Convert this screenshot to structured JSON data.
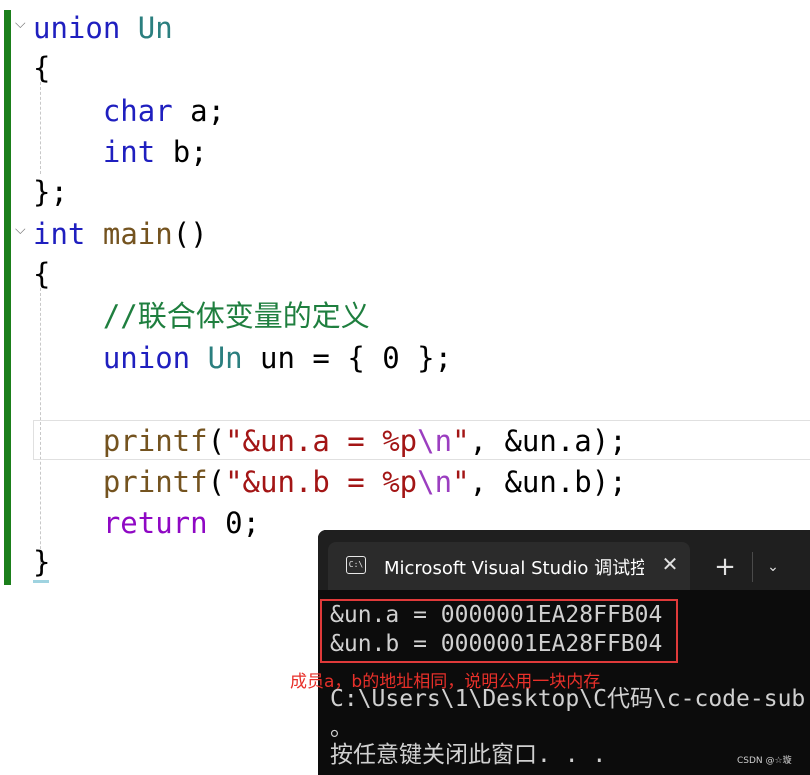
{
  "editor": {
    "code": {
      "l1": {
        "kw": "union",
        "name": "Un"
      },
      "l2": "{",
      "l3": {
        "type": "char",
        "var": "a;"
      },
      "l4": {
        "type": "int",
        "var": "b;"
      },
      "l5": "};",
      "l6": {
        "type": "int",
        "fn": "main",
        "paren": "()"
      },
      "l7": "{",
      "l8": "//联合体变量的定义",
      "l9": {
        "kw": "union",
        "type": "Un",
        "rest": "un = { 0 };"
      },
      "l11": {
        "fn": "printf",
        "open": "(",
        "str1": "\"&un.a = %p",
        "esc": "\\n",
        "str2": "\"",
        "rest": ", &un.a);"
      },
      "l12": {
        "fn": "printf",
        "open": "(",
        "str1": "\"&un.b = %p",
        "esc": "\\n",
        "str2": "\"",
        "rest": ", &un.b);"
      },
      "l13": {
        "kw": "return",
        "rest": "0;"
      },
      "l14": "}"
    }
  },
  "terminal": {
    "tab_title": "Microsoft Visual Studio 调试控制台",
    "tab_icon": "C:\\",
    "close_glyph": "✕",
    "new_tab_glyph": "+",
    "dropdown_glyph": "⌄",
    "lines": [
      "&un.a = 0000001EA28FFB04",
      "&un.b = 0000001EA28FFB04",
      "",
      "C:\\Users\\1\\Desktop\\C代码\\c-code-sub",
      "。",
      "按任意键关闭此窗口. . ."
    ]
  },
  "annotation": "成员a，b的地址相同，说明公用一块内存",
  "watermark": "CSDN @☆璇",
  "colors": {
    "keyword": "#1f1fbf",
    "type": "#2b7f7f",
    "function": "#74531f",
    "comment": "#1f7f3f",
    "string": "#a31515",
    "return": "#8f08c4",
    "annotation": "#e8302a",
    "change_bar": "#1b7f1b"
  }
}
